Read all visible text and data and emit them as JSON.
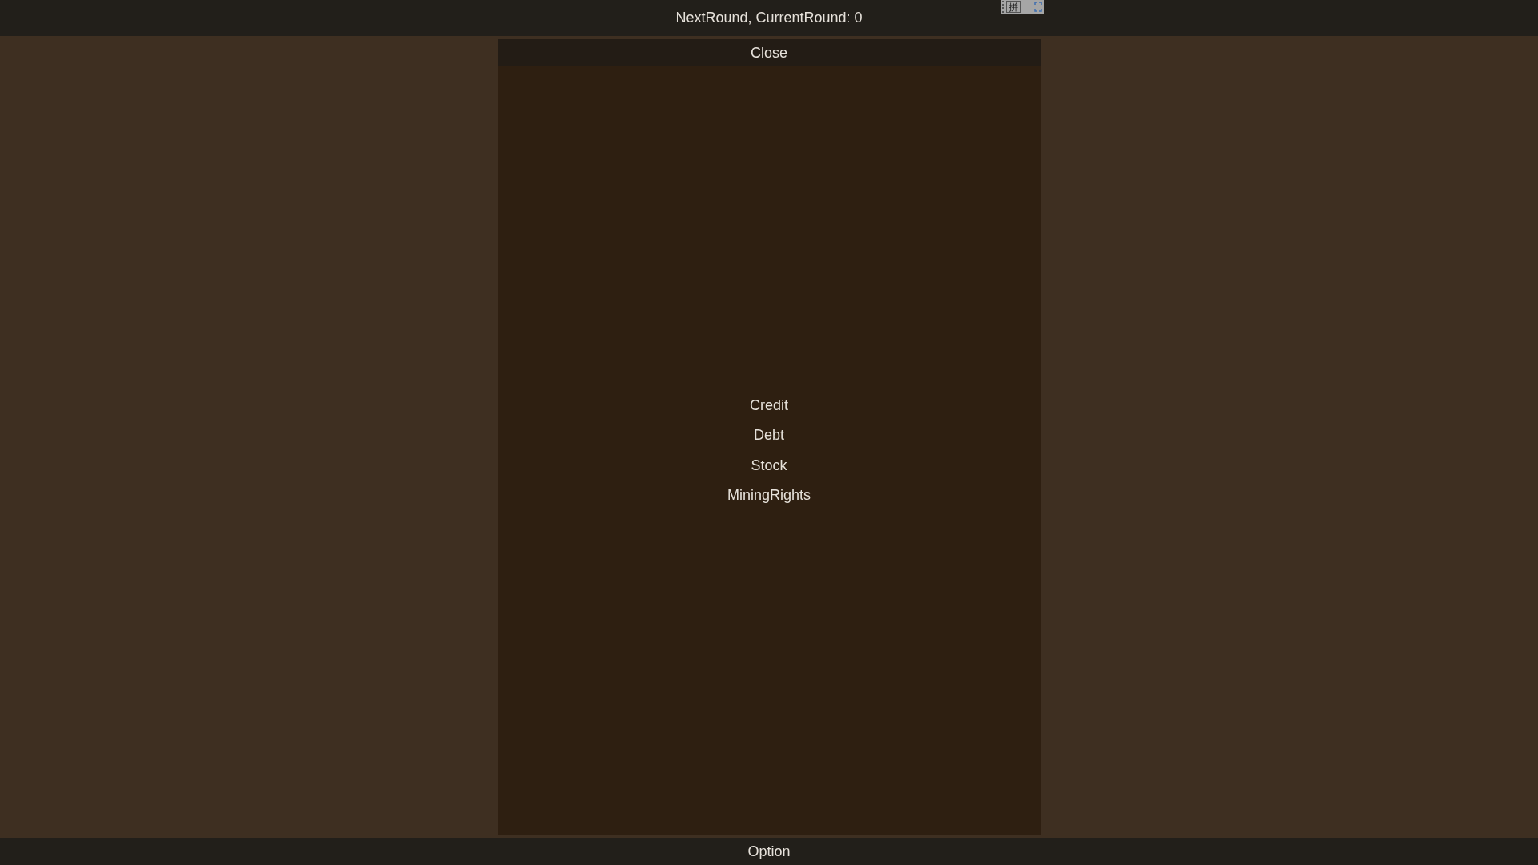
{
  "top_bar": {
    "title": "NextRound, CurrentRound: 0"
  },
  "ime_toolbar": {
    "mode": "拼"
  },
  "panel": {
    "close_button": "Close",
    "items": [
      {
        "label": "Credit"
      },
      {
        "label": "Debt"
      },
      {
        "label": "Stock"
      },
      {
        "label": "MiningRights"
      }
    ]
  },
  "bottom_bar": {
    "option_button": "Option"
  }
}
